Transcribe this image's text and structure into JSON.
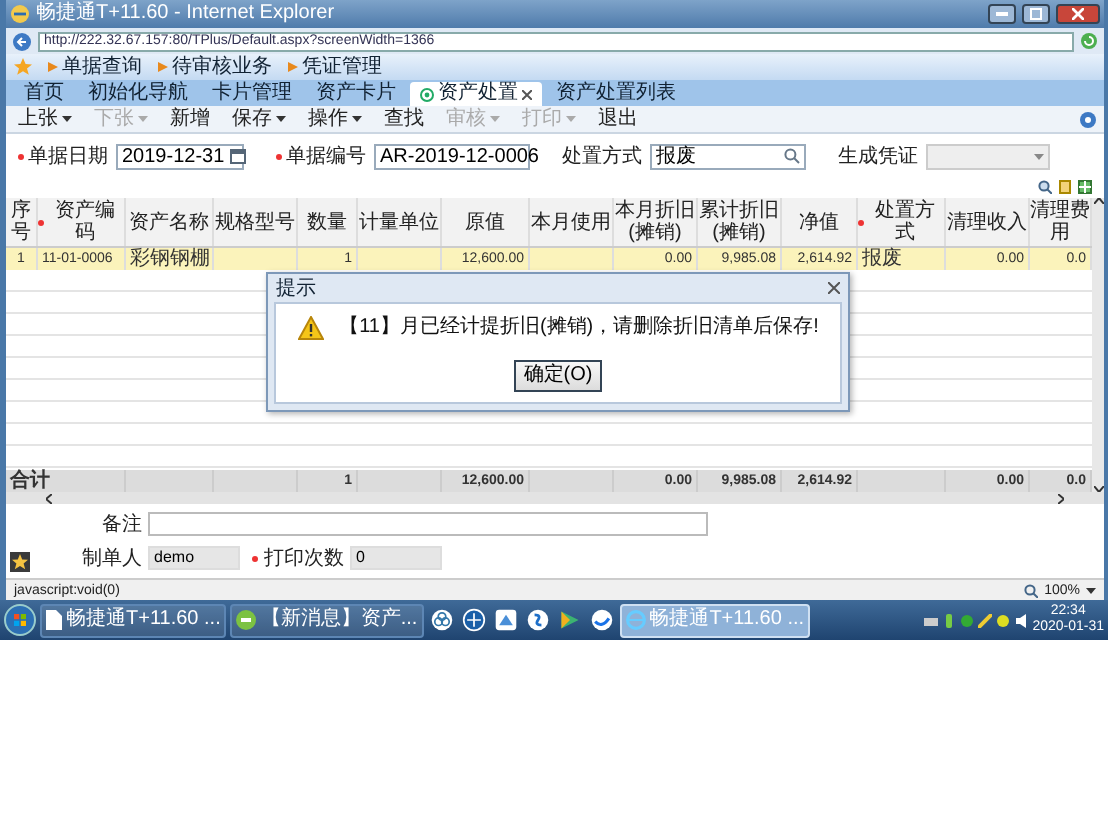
{
  "window": {
    "title": "畅捷通T+11.60 - Internet Explorer"
  },
  "address_bar": {
    "url": "http://222.32.67.157:80/TPlus/Default.aspx?screenWidth=1366"
  },
  "favorites": [
    {
      "label": "单据查询"
    },
    {
      "label": "待审核业务"
    },
    {
      "label": "凭证管理"
    }
  ],
  "tabs": [
    {
      "label": "首页",
      "selected": false
    },
    {
      "label": "初始化导航",
      "selected": false
    },
    {
      "label": "卡片管理",
      "selected": false
    },
    {
      "label": "资产卡片",
      "selected": false
    },
    {
      "label": "资产处置",
      "selected": true
    },
    {
      "label": "资产处置列表",
      "selected": false
    }
  ],
  "toolbar": [
    {
      "label": "上张",
      "dropdown": true,
      "disabled": false
    },
    {
      "label": "下张",
      "dropdown": true,
      "disabled": true
    },
    {
      "label": "新增",
      "dropdown": false,
      "disabled": false
    },
    {
      "label": "保存",
      "dropdown": true,
      "disabled": false
    },
    {
      "label": "操作",
      "dropdown": true,
      "disabled": false
    },
    {
      "label": "查找",
      "dropdown": false,
      "disabled": false
    },
    {
      "label": "审核",
      "dropdown": true,
      "disabled": true
    },
    {
      "label": "打印",
      "dropdown": true,
      "disabled": true
    },
    {
      "label": "退出",
      "dropdown": false,
      "disabled": false
    }
  ],
  "form": {
    "fields": [
      {
        "label": "单据日期",
        "required": true,
        "kind": "date",
        "value": "2019-12-31"
      },
      {
        "label": "单据编号",
        "required": true,
        "kind": "text",
        "value": "AR-2019-12-0006"
      },
      {
        "label": "处置方式",
        "required": false,
        "kind": "lookup",
        "value": "报废"
      },
      {
        "label": "生成凭证",
        "required": false,
        "kind": "select",
        "disabled": true
      }
    ]
  },
  "table": {
    "columns": [
      {
        "label": "序号",
        "required": false
      },
      {
        "label": "资产编码",
        "required": true
      },
      {
        "label": "资产名称",
        "required": false
      },
      {
        "label": "规格型号",
        "required": false
      },
      {
        "label": "数量",
        "required": false
      },
      {
        "label": "计量单位",
        "required": false
      },
      {
        "label": "原值",
        "required": false
      },
      {
        "label": "本月使用",
        "required": false
      },
      {
        "label": "本月折旧(摊销)",
        "required": false
      },
      {
        "label": "累计折旧(摊销)",
        "required": false
      },
      {
        "label": "净值",
        "required": false
      },
      {
        "label": "处置方式",
        "required": true
      },
      {
        "label": "清理收入",
        "required": false
      },
      {
        "label": "清理费用",
        "required": false
      }
    ],
    "rows": [
      {
        "selected": true,
        "cells": [
          "1",
          "11-01-0006",
          "彩钢钢棚",
          null,
          "1",
          null,
          "12,600.00",
          null,
          "0.00",
          "9,985.08",
          "2,614.92",
          "报废",
          "0.00",
          "0.0"
        ]
      }
    ],
    "totals": {
      "label": "合计",
      "cells": [
        null,
        null,
        null,
        null,
        "1",
        null,
        "12,600.00",
        null,
        "0.00",
        "9,985.08",
        "2,614.92",
        null,
        "0.00",
        "0.0"
      ]
    }
  },
  "footer": {
    "fields": [
      {
        "label": "备注",
        "kind": "text",
        "required": false
      },
      {
        "label": "制单人",
        "kind": "readonly",
        "required": false,
        "value": "demo"
      },
      {
        "label": "打印次数",
        "kind": "readonly",
        "required": true,
        "value": "0"
      }
    ]
  },
  "dialog": {
    "title": "提示",
    "message": "【11】月已经计提折旧(摊销)，请删除折旧清单后保存!",
    "buttons": [
      "确定(O)"
    ]
  },
  "status_bar": {
    "text": "javascript:void(0)",
    "zoom": "100%"
  },
  "taskbar": {
    "windows": [
      {
        "label": "畅捷通T+11.60 ...",
        "selected": false
      },
      {
        "label": "【新消息】资产...",
        "selected": false
      },
      {
        "label": "畅捷通T+11.60 ...",
        "selected": true
      }
    ],
    "clock": {
      "time": "22:34",
      "date": "2020-01-31"
    }
  }
}
